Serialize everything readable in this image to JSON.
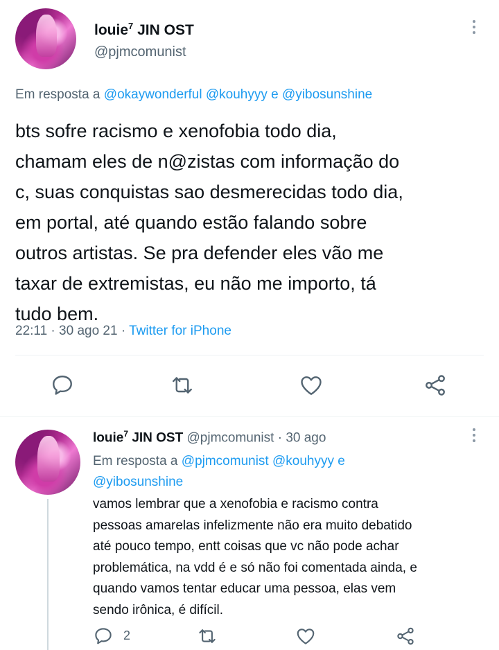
{
  "main_tweet": {
    "display_name": "louie",
    "name_sup": "7",
    "name_suffix": "JIN OST",
    "handle": "@pjmcomunist",
    "reply_prefix": "Em resposta a",
    "reply_to": [
      "@okaywonderful",
      "@kouhyyy"
    ],
    "reply_conj": "e",
    "reply_last": "@yibosunshine",
    "text_lines": [
      "bts sofre racismo e xenofobia todo dia,",
      "chamam eles de n@zistas com informação do",
      "c, suas conquistas sao desmerecidas todo dia,",
      "em portal, até quando estão falando sobre",
      "outros artistas. Se pra defender eles vão me",
      "taxar de extremistas, eu não me importo, tá",
      "tudo bem."
    ],
    "time": "22:11",
    "sep1": "·",
    "date": "30 ago 21",
    "sep2": "·",
    "source": "Twitter for iPhone"
  },
  "reply_tweet": {
    "display_name": "louie",
    "name_sup": "7",
    "name_suffix": "JIN OST",
    "handle": "@pjmcomunist",
    "sep": "·",
    "date": "30 ago",
    "reply_prefix": "Em resposta a",
    "reply_to_line1": [
      "@pjmcomunist",
      "@kouhyyy"
    ],
    "reply_conj": "e",
    "reply_to_line2": "@yibosunshine",
    "text_lines": [
      "vamos lembrar que a xenofobia e racismo contra",
      "pessoas amarelas infelizmente não era muito debatido",
      "até pouco tempo, entt coisas que vc não pode achar",
      "problemática, na vdd é e só não foi comentada ainda, e",
      "quando vamos tentar educar uma pessoa, elas vem",
      "sendo irônica, é difícil."
    ],
    "reply_count": "2"
  },
  "icons": [
    "more-icon",
    "reply-icon",
    "retweet-icon",
    "like-icon",
    "share-icon"
  ],
  "colors": {
    "link": "#1d9bf0",
    "muted": "#536471",
    "text": "#0f1419",
    "divider": "#eff3f4"
  }
}
